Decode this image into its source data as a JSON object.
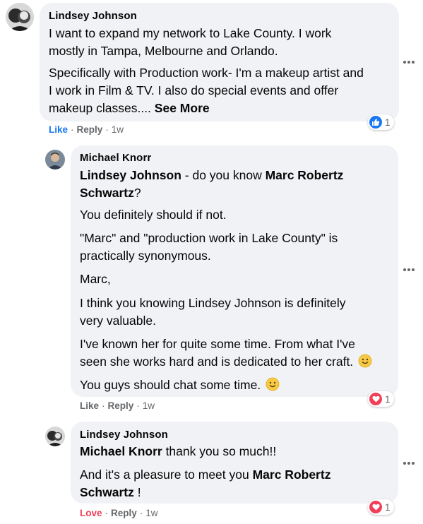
{
  "comments": [
    {
      "author": "Lindsey Johnson",
      "lines": [
        "I want to expand my network to Lake County. I work",
        "mostly in Tampa, Melbourne and Orlando.",
        "Specifically with Production work- I'm a makeup artist and",
        "I work in Film & TV. I also do special events and offer",
        "makeup classes...."
      ],
      "see_more": "See More",
      "action_primary": "Like",
      "action_reply": "Reply",
      "time": "1w",
      "reaction": {
        "icon": "like-icon",
        "count": "1"
      }
    },
    {
      "author": "Michael Knorr",
      "mention_1": "Lindsey Johnson",
      "line_1_rest": " - do you know ",
      "mention_2a": "Marc Robertz",
      "mention_2b": "Schwartz",
      "line_2_rest": "?",
      "p2": "You definitely should if not.",
      "p3a": "\"Marc\" and \"production work in Lake County\" is",
      "p3b": "practically synonymous.",
      "p4": "Marc,",
      "p5a": "I think you knowing Lindsey Johnson is definitely",
      "p5b": "very valuable.",
      "p6a": "I've known her for quite some time. From what I've",
      "p6b": "seen she works hard and is dedicated to her craft.",
      "p7": "You guys should chat some time.",
      "action_primary": "Like",
      "action_reply": "Reply",
      "time": "1w",
      "reaction": {
        "icon": "love-icon",
        "count": "1"
      }
    },
    {
      "author": "Lindsey Johnson",
      "mention_1": "Michael Knorr",
      "line_1_rest": " thank you so much!!",
      "p2a": "And it's a pleasure to meet you ",
      "mention_2a": "Marc Robertz",
      "mention_2b": "Schwartz",
      "p2_end": " !",
      "action_primary": "Love",
      "action_reply": "Reply",
      "time": "1w",
      "reaction": {
        "icon": "love-icon",
        "count": "1"
      }
    }
  ],
  "separator": "·",
  "colors": {
    "bubble": "#f0f2f5",
    "secondary_text": "#65676b",
    "like_blue": "#1877f2",
    "love_red": "#f33e58"
  }
}
